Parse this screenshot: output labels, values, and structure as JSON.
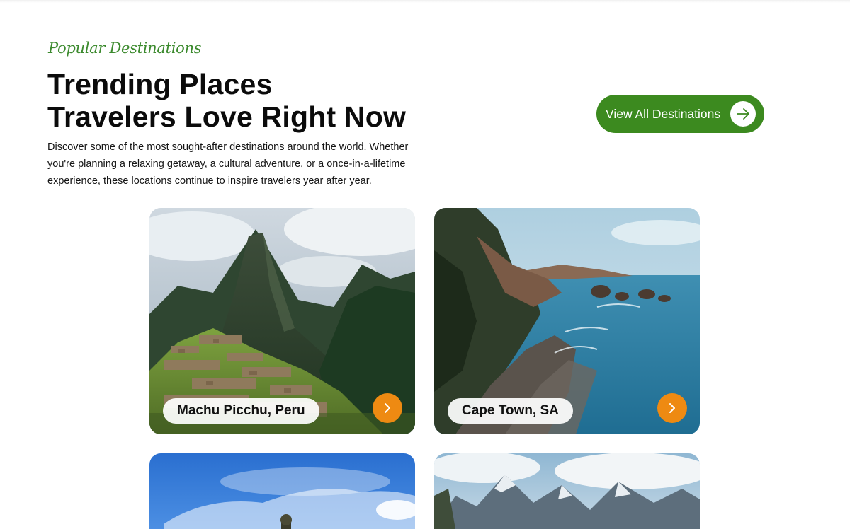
{
  "section": {
    "eyebrow": "Popular Destinations",
    "headline_line1": "Trending Places",
    "headline_line2": "Travelers Love Right Now",
    "intro": "Discover some of the most sought-after destinations around the world. Whether you're planning a relaxing getaway, a cultural adventure, or a once-in-a-lifetime experience, these locations continue to inspire travelers year after year."
  },
  "cta": {
    "label": "View All Destinations",
    "icon": "arrow-right-icon"
  },
  "destinations": [
    {
      "name": "Machu Picchu, Peru",
      "icon": "chevron-right-icon"
    },
    {
      "name": "Cape Town, SA",
      "icon": "chevron-right-icon"
    },
    {
      "name": "",
      "icon": ""
    },
    {
      "name": "",
      "icon": ""
    }
  ],
  "colors": {
    "brand_green": "#3c8a1f",
    "accent_orange": "#ee8a12",
    "eyebrow_green": "#3c8a2e"
  }
}
